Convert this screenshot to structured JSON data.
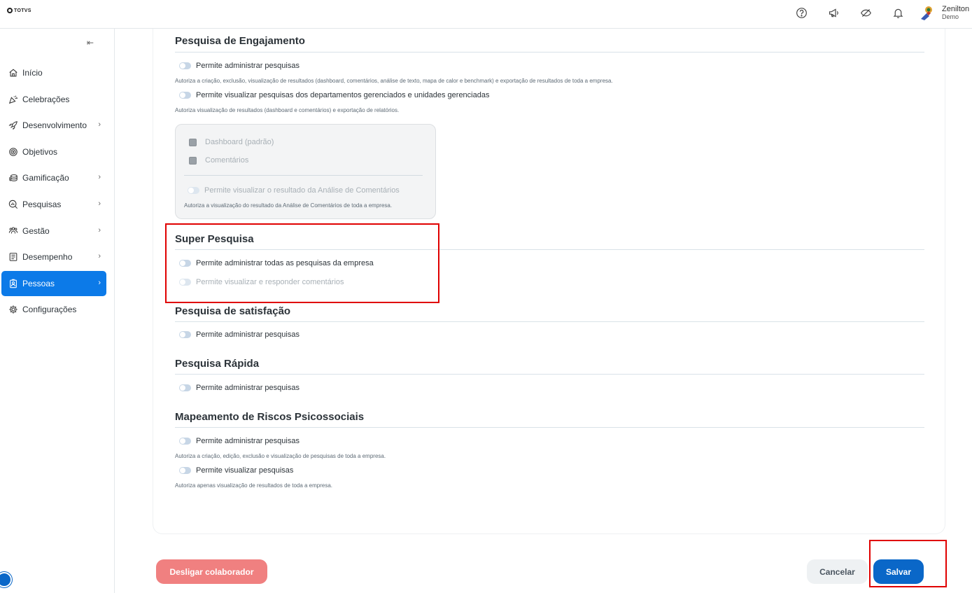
{
  "brand": {
    "logo_text": "TOTVS"
  },
  "topbar": {
    "icons": [
      "help-icon",
      "megaphone-icon",
      "no-eye-icon",
      "bell-icon"
    ],
    "user_name": "Zenilton",
    "user_sub": "Demo"
  },
  "sidebar": {
    "collapse_glyph": "⇤",
    "items": [
      {
        "label": "Início",
        "icon": "home-icon",
        "has_children": false
      },
      {
        "label": "Celebrações",
        "icon": "party-icon",
        "has_children": false
      },
      {
        "label": "Desenvolvimento",
        "icon": "rocket-icon",
        "has_children": true
      },
      {
        "label": "Objetivos",
        "icon": "target-icon",
        "has_children": false
      },
      {
        "label": "Gamificação",
        "icon": "coins-icon",
        "has_children": true
      },
      {
        "label": "Pesquisas",
        "icon": "survey-icon",
        "has_children": true
      },
      {
        "label": "Gestão",
        "icon": "team-icon",
        "has_children": true
      },
      {
        "label": "Desempenho",
        "icon": "checklist-icon",
        "has_children": true
      },
      {
        "label": "Pessoas",
        "icon": "person-badge-icon",
        "has_children": true,
        "active": true
      },
      {
        "label": "Configurações",
        "icon": "gear-icon",
        "has_children": false
      }
    ]
  },
  "sections": {
    "engajamento": {
      "title": "Pesquisa de Engajamento",
      "perm_admin": "Permite administrar pesquisas",
      "perm_admin_desc": "Autoriza a criação, exclusão, visualização de resultados (dashboard, comentários, análise de texto, mapa de calor e benchmark) e exportação de resultados de toda a empresa.",
      "perm_view_dept": "Permite visualizar pesquisas dos departamentos gerenciados e unidades gerenciadas",
      "perm_view_dept_desc": "Autoriza visualização de resultados (dashboard e comentários) e exportação de relatórios.",
      "sub": {
        "check_dashboard": "Dashboard (padrão)",
        "check_comments": "Comentários",
        "perm_analysis": "Permite visualizar o resultado da Análise de Comentários",
        "perm_analysis_desc": "Autoriza a visualização do resultado da Análise de Comentários de toda a empresa."
      }
    },
    "super": {
      "title": "Super Pesquisa",
      "perm_admin_all": "Permite administrar todas as pesquisas da empresa",
      "perm_comments": "Permite visualizar e responder comentários"
    },
    "satisfacao": {
      "title": "Pesquisa de satisfação",
      "perm_admin": "Permite administrar pesquisas"
    },
    "rapida": {
      "title": "Pesquisa Rápida",
      "perm_admin": "Permite administrar pesquisas"
    },
    "riscos": {
      "title": "Mapeamento de Riscos Psicossociais",
      "perm_admin": "Permite administrar pesquisas",
      "perm_admin_desc": "Autoriza a criação, edição, exclusão e visualização de pesquisas de toda a empresa.",
      "perm_view": "Permite visualizar pesquisas",
      "perm_view_desc": "Autoriza apenas visualização de resultados de toda a empresa."
    }
  },
  "footer": {
    "dismiss_label": "Desligar colaborador",
    "cancel_label": "Cancelar",
    "save_label": "Salvar"
  },
  "colors": {
    "accent": "#0c7ae8",
    "primary_button": "#0a67c8",
    "danger_button": "#f08080",
    "highlight_border": "#e00000"
  }
}
